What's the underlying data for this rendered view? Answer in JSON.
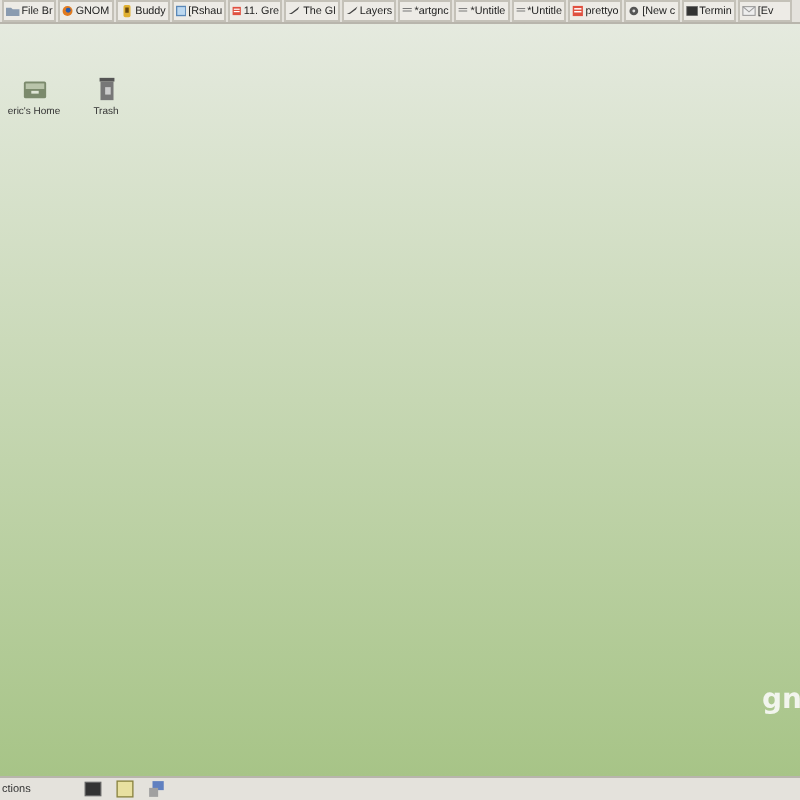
{
  "taskbar": {
    "buttons": [
      {
        "label": "File Br",
        "kind": "folder"
      },
      {
        "label": "GNOM",
        "kind": "browser"
      },
      {
        "label": "Buddy",
        "kind": "chat"
      },
      {
        "label": "[Rshau",
        "kind": "window"
      },
      {
        "label": "11. Gre",
        "kind": "image"
      },
      {
        "label": "The Gl",
        "kind": "pen"
      },
      {
        "label": "Layers",
        "kind": "pen"
      },
      {
        "label": "*artgnc",
        "kind": "editor"
      },
      {
        "label": "*Untitle",
        "kind": "editor"
      },
      {
        "label": "*Untitle",
        "kind": "editor"
      },
      {
        "label": "prettyo",
        "kind": "image"
      },
      {
        "label": "[New c",
        "kind": "gear"
      },
      {
        "label": "Termin",
        "kind": "terminal"
      },
      {
        "label": "[Ev",
        "kind": "mail"
      }
    ]
  },
  "desktop": {
    "icons": [
      {
        "label": "eric's Home",
        "kind": "home"
      },
      {
        "label": "Trash",
        "kind": "trash"
      }
    ],
    "logo": "gn"
  },
  "bottom_panel": {
    "label": "ctions",
    "launchers": [
      {
        "kind": "terminal"
      },
      {
        "kind": "notes"
      },
      {
        "kind": "network"
      }
    ]
  }
}
